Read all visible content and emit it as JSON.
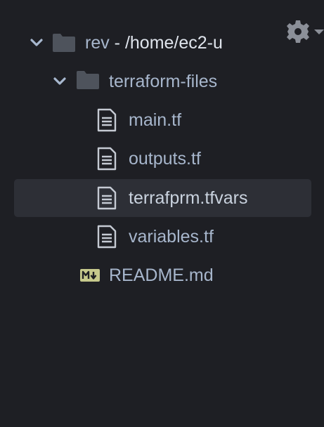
{
  "settings": {
    "icon": "gear-icon"
  },
  "tree": {
    "root": {
      "name": "rev",
      "path": " - /home/ec2-u",
      "icon": "folder-icon",
      "expanded": true
    },
    "folder": {
      "name": "terraform-files",
      "icon": "folder-icon",
      "expanded": true
    },
    "files": [
      {
        "name": "main.tf",
        "icon": "file-text-icon"
      },
      {
        "name": "outputs.tf",
        "icon": "file-text-icon"
      },
      {
        "name": "terrafprm.tfvars",
        "icon": "file-text-icon",
        "selected": true
      },
      {
        "name": "variables.tf",
        "icon": "file-text-icon"
      }
    ],
    "readme": {
      "name": "README.md",
      "icon": "markdown-icon",
      "icon_color": "#c6c98c"
    }
  }
}
